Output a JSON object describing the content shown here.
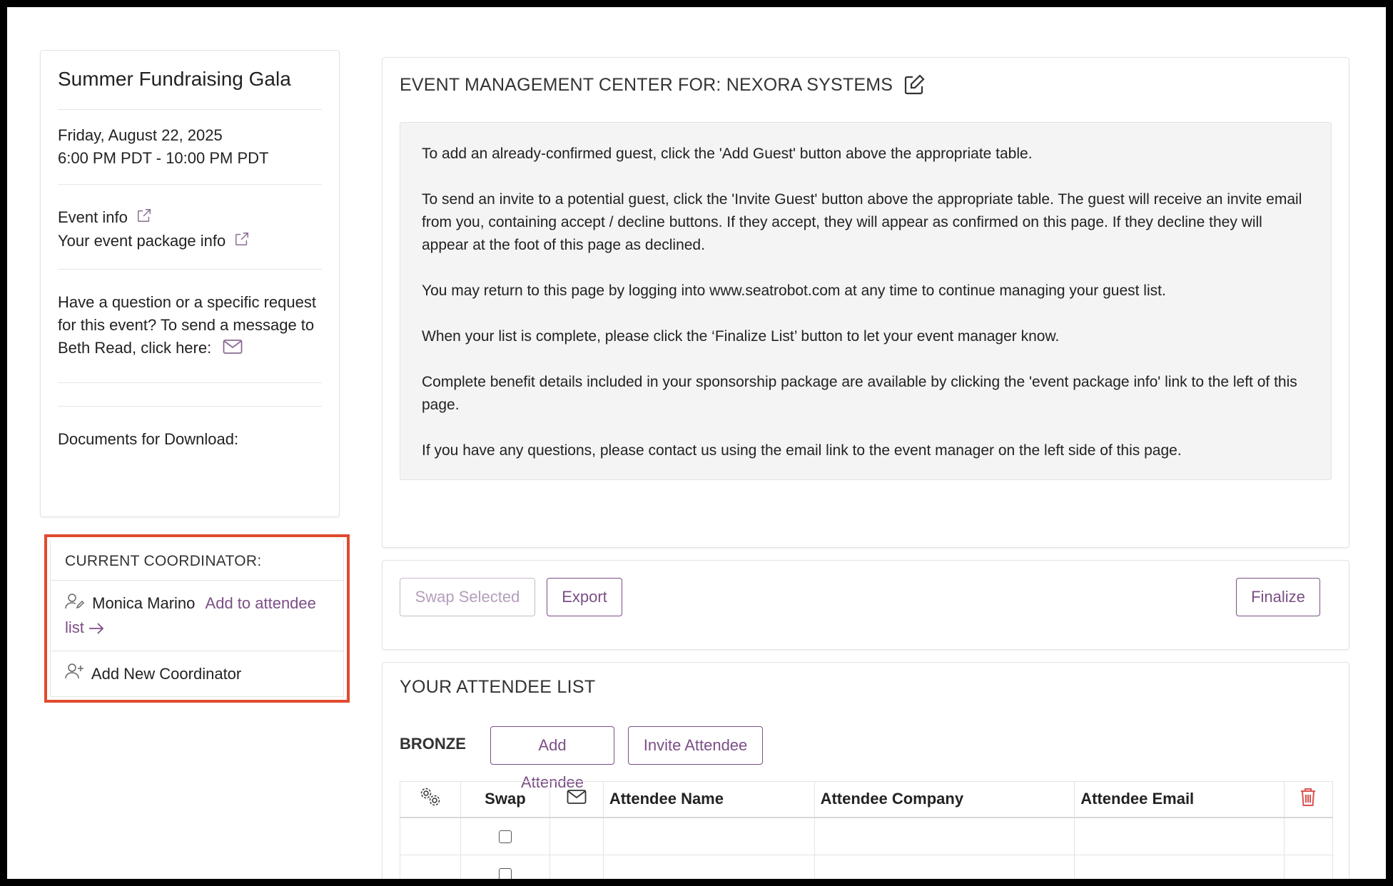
{
  "event": {
    "title": "Summer Fundraising Gala",
    "date": "Friday, August 22, 2025",
    "time": "6:00 PM PDT - 10:00 PM PDT",
    "event_info_link": "Event info",
    "package_info_link": "Your event package info",
    "question_text": "Have a question or a specific request for this event? To send a message to Beth Read, click here:",
    "documents_label": "Documents for Download:"
  },
  "coordinator": {
    "header": "CURRENT COORDINATOR:",
    "name": "Monica Marino",
    "add_link": "Add to attendee list",
    "add_new": "Add New Coordinator"
  },
  "management": {
    "title": "EVENT MANAGEMENT CENTER FOR: NEXORA SYSTEMS",
    "instructions": [
      "To add an already-confirmed guest, click the 'Add Guest' button above the appropriate table.",
      "To send an invite to a potential guest, click the 'Invite Guest' button above the appropriate table. The guest will receive an invite email from you, containing accept / decline buttons. If they accept, they will appear as confirmed on this page. If they decline they will appear at the foot of this page as declined.",
      "You may return to this page by logging into www.seatrobot.com at any time to continue managing your guest list.",
      "When your list is complete, please click the ‘Finalize List’ button to let your event manager know.",
      "Complete benefit details included in your sponsorship package are available by clicking the 'event package info' link to the left of this page.",
      "If you have any questions, please contact us using the email link to the event manager on the left side of this page."
    ]
  },
  "actions": {
    "swap_selected": "Swap Selected",
    "export": "Export",
    "finalize": "Finalize"
  },
  "attendees": {
    "title": "YOUR ATTENDEE LIST",
    "tier": "BRONZE",
    "add_attendee": "Add Attendee",
    "invite_attendee": "Invite Attendee",
    "columns": {
      "swap": "Swap",
      "name": "Attendee Name",
      "company": "Attendee Company",
      "email": "Attendee Email"
    }
  },
  "colors": {
    "accent": "#7b4f86",
    "highlight": "#e04a2f",
    "delete": "#d9534f"
  }
}
